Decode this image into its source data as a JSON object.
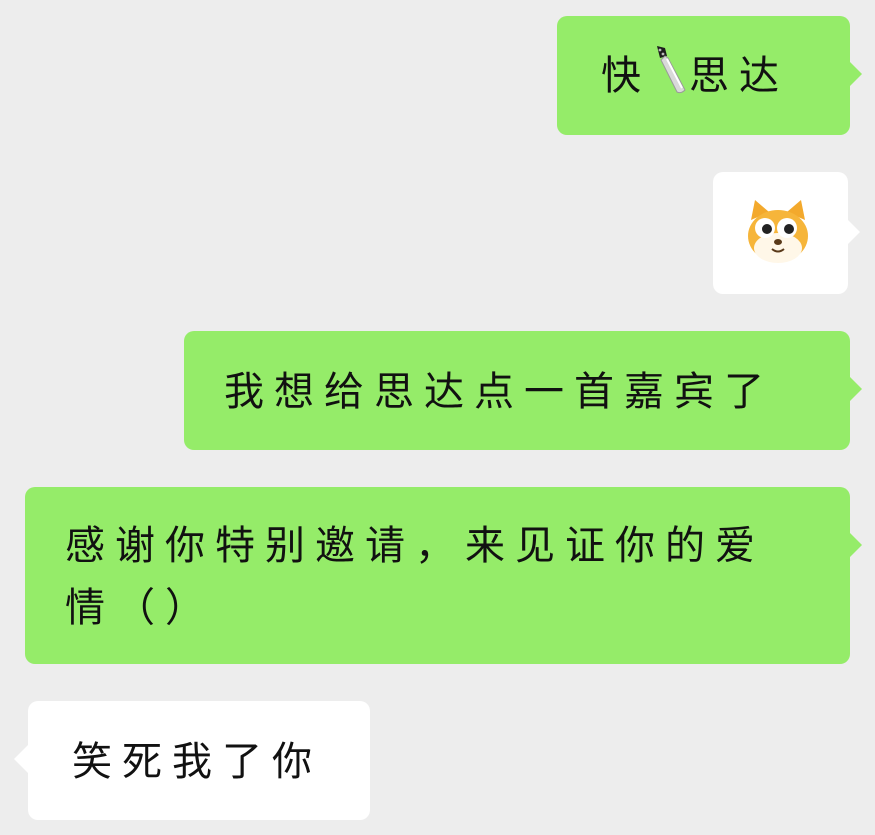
{
  "messages": [
    {
      "side": "sent",
      "text_before": "快",
      "emoji": "knife-icon",
      "text_after": "思达"
    },
    {
      "side": "sent",
      "sticker": "doge-cat-sticker"
    },
    {
      "side": "sent",
      "text": "我想给思达点一首嘉宾了"
    },
    {
      "side": "sent",
      "text": "感谢你特别邀请，来见证你的爱情（）"
    },
    {
      "side": "recv",
      "text": "笑死我了你"
    }
  ],
  "colors": {
    "background": "#ededed",
    "sent_bubble": "#95ec69",
    "received_bubble": "#ffffff"
  }
}
